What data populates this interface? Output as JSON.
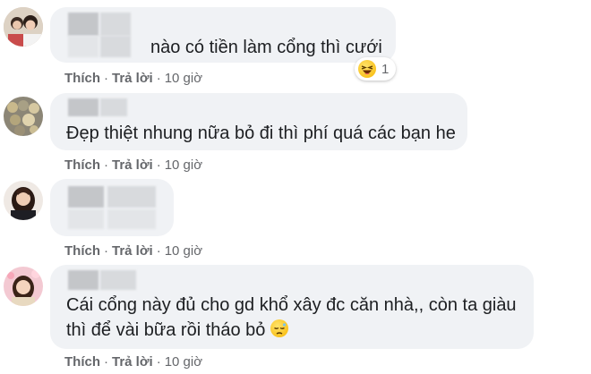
{
  "comments": [
    {
      "text": "nào có tiền làm cổng thì cưới",
      "actions": {
        "like": "Thích",
        "reply": "Trả lời",
        "sep": "·",
        "time": "10 giờ"
      },
      "reaction": {
        "emoji": "laughing-emoji",
        "count": "1"
      }
    },
    {
      "text": "Đẹp thiệt nhung nữa bỏ đi thì phí quá các bạn he",
      "actions": {
        "like": "Thích",
        "reply": "Trả lời",
        "sep": "·",
        "time": "10 giờ"
      }
    },
    {
      "text": "",
      "actions": {
        "like": "Thích",
        "reply": "Trả lời",
        "sep": "·",
        "time": "10 giờ"
      }
    },
    {
      "lines": [
        "Cái cổng này đủ cho gd khổ xây đc căn nhà,, còn ta giàu",
        "thì để vài bữa rồi tháo bỏ"
      ],
      "actions": {
        "like": "Thích",
        "reply": "Trả lời",
        "sep": "·",
        "time": "10 giờ"
      },
      "inline_emoji": "disappointed-emoji"
    }
  ],
  "colors": {
    "bubble": "#f0f2f5",
    "action_text": "#65676b",
    "comment_text": "#1c1e21"
  }
}
